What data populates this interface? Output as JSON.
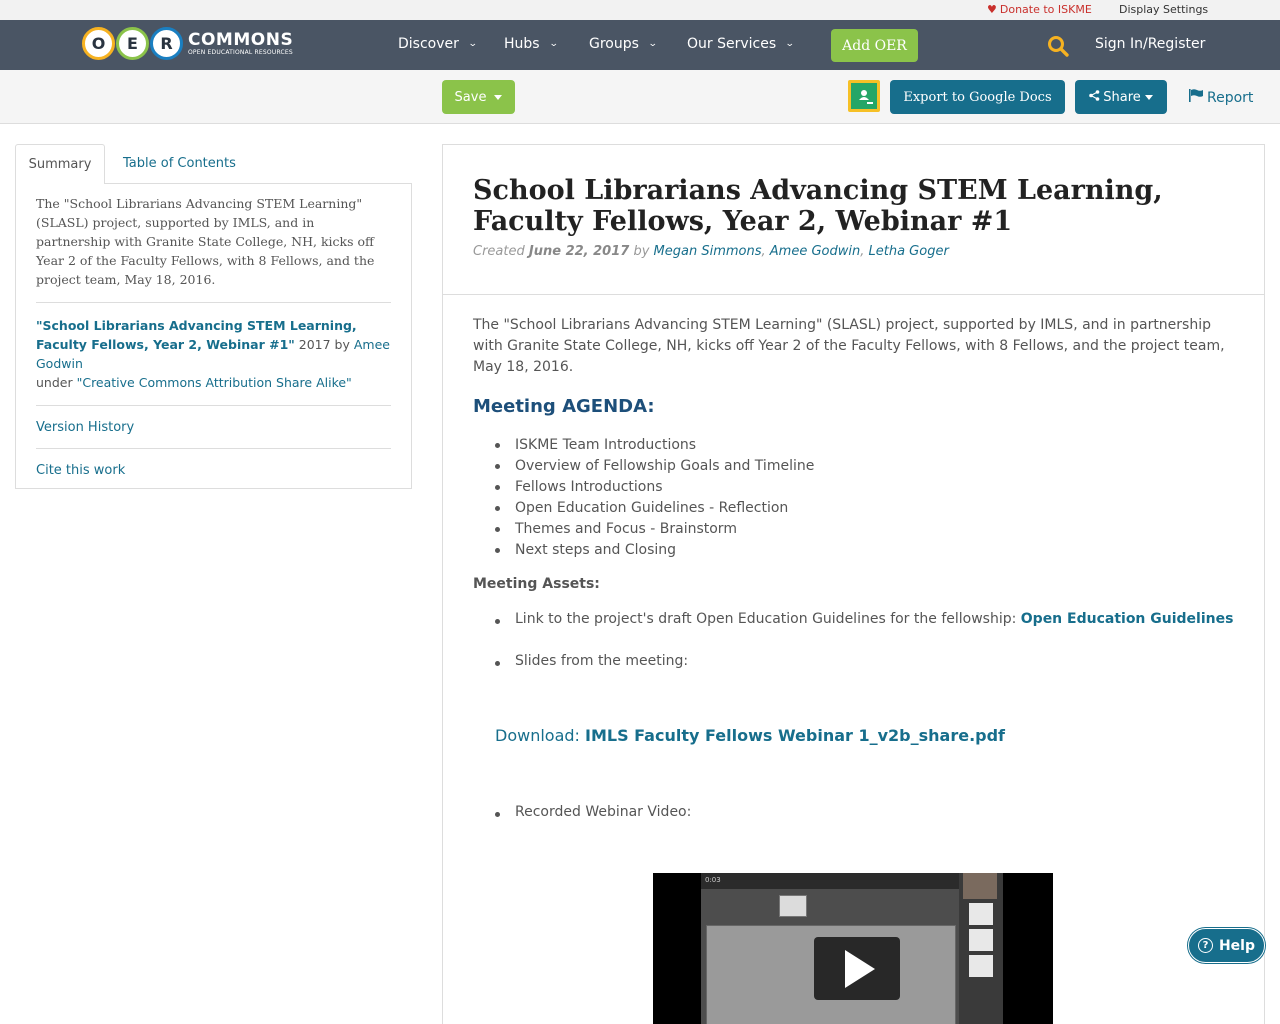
{
  "utility": {
    "donate": "Donate to ISKME",
    "display_settings": "Display Settings"
  },
  "header": {
    "logo_letters": [
      "O",
      "E",
      "R"
    ],
    "logo_colors": [
      "#f6b221",
      "#8bc34a",
      "#1a7fc1"
    ],
    "logo_title": "COMMONS",
    "logo_subtitle": "OPEN EDUCATIONAL RESOURCES",
    "nav": [
      "Discover",
      "Hubs",
      "Groups",
      "Our Services"
    ],
    "add_oer": "Add OER",
    "sign_in": "Sign In/Register"
  },
  "toolbar": {
    "save": "Save",
    "export": "Export to Google Docs",
    "share": "Share",
    "report": "Report"
  },
  "sidebar": {
    "tabs": [
      "Summary",
      "Table of Contents"
    ],
    "summary": "The \"School Librarians Advancing STEM Learning\" (SLASL) project, supported by IMLS, and in partnership with Granite State College, NH, kicks off Year 2 of the Faculty Fellows, with 8 Fellows, and the project team, May 18, 2016.",
    "attribution": {
      "title": "\"School Librarians Advancing STEM Learning, Faculty Fellows, Year 2, Webinar #1\"",
      "year_by": " 2017 by ",
      "author": "Amee Godwin",
      "under": "under ",
      "license": "\"Creative Commons Attribution Share Alike\""
    },
    "version_history": "Version History",
    "cite": "Cite this work"
  },
  "main": {
    "title": "School Librarians Advancing STEM Learning, Faculty Fellows, Year 2, Webinar #1",
    "created_label": "Created",
    "created_date": "June 22, 2017",
    "by": "by",
    "authors": [
      "Megan Simmons",
      "Amee Godwin",
      "Letha Goger"
    ],
    "intro": "The \"School Librarians Advancing STEM Learning\" (SLASL) project, supported by IMLS, and in partnership with Granite State College, NH, kicks off Year 2 of the Faculty Fellows, with 8 Fellows, and the project team, May 18, 2016.",
    "agenda_heading": "Meeting AGENDA:",
    "agenda": [
      "ISKME Team Introductions",
      "Overview of Fellowship Goals and Timeline",
      "Fellows Introductions",
      "Open Education Guidelines - Reflection",
      "Themes and Focus - Brainstorm",
      "Next steps and Closing"
    ],
    "assets_heading": "Meeting Assets:",
    "asset_link_text": "Link to the project's draft Open Education Guidelines for the fellowship: ",
    "asset_link_label": "Open Education Guidelines",
    "slides_text": "Slides from the meeting:",
    "download_label": "Download: ",
    "download_file": "IMLS Faculty Fellows Webinar 1_v2b_share.pdf",
    "video_text": "Recorded Webinar Video:",
    "video_time": "0:03"
  },
  "help": "Help"
}
